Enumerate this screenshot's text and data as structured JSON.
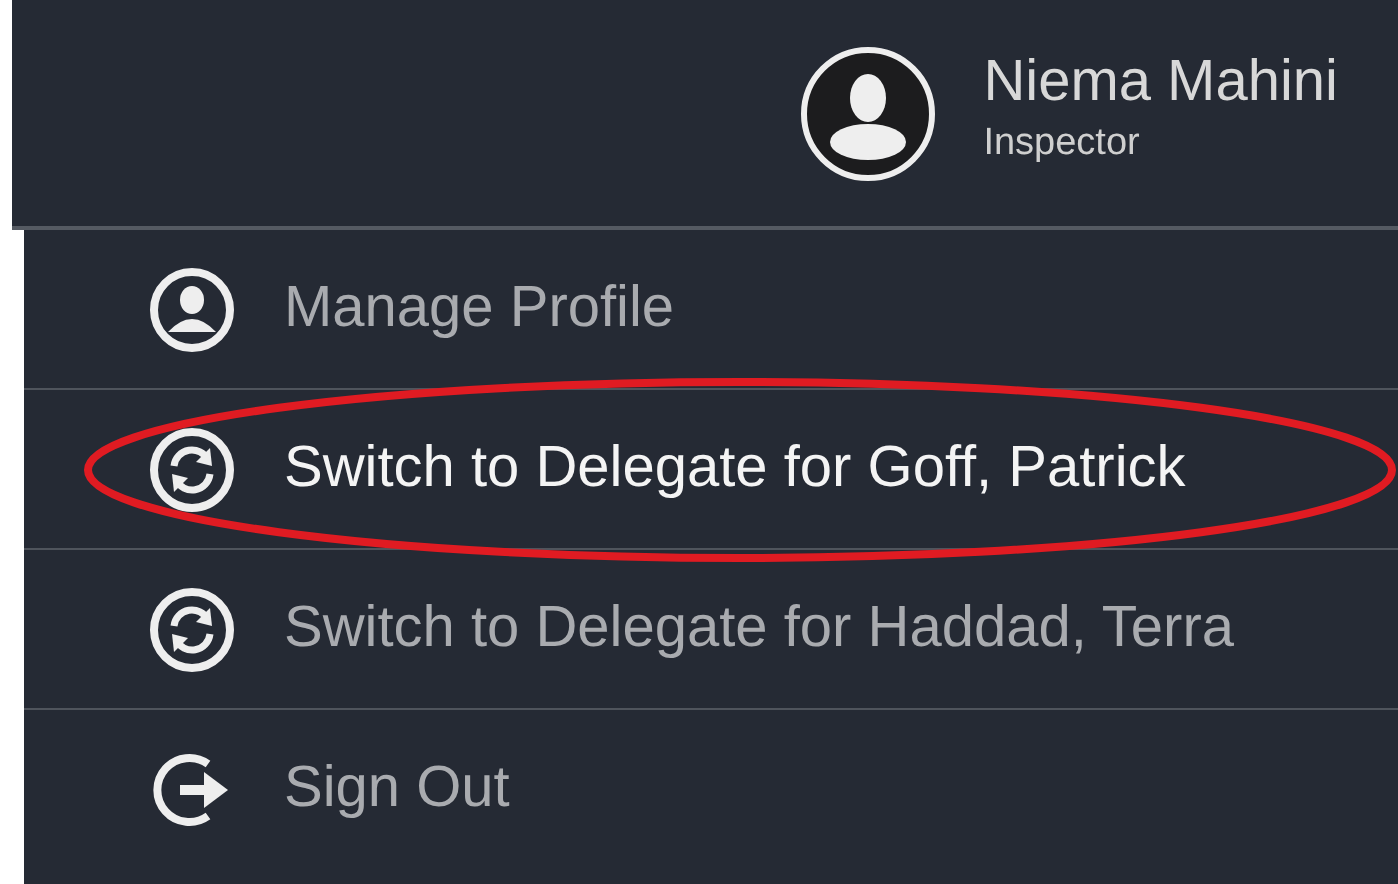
{
  "user": {
    "name": "Niema Mahini",
    "role": "Inspector"
  },
  "menu": [
    {
      "kind": "profile",
      "label": "Manage Profile",
      "selected": false,
      "circled": false
    },
    {
      "kind": "switch",
      "label": "Switch to Delegate for Goff, Patrick",
      "selected": true,
      "circled": true
    },
    {
      "kind": "switch",
      "label": "Switch to Delegate for Haddad, Terra",
      "selected": false,
      "circled": false
    },
    {
      "kind": "signout",
      "label": "Sign Out",
      "selected": false,
      "circled": false
    }
  ]
}
